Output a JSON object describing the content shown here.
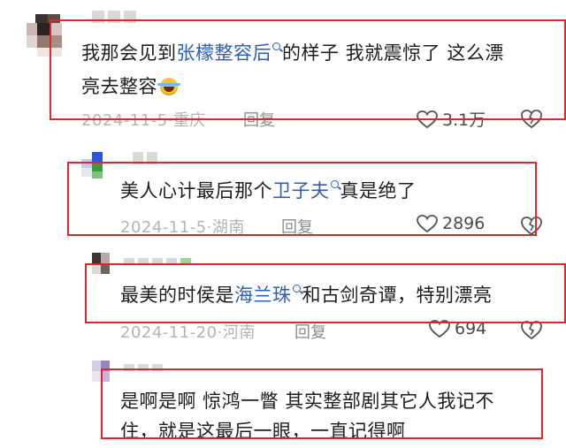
{
  "comments": [
    {
      "text_before": "我那会见到",
      "keyword": "张檬整容后",
      "text_after": "的样子 我就震惊了 这么漂",
      "line2": "亮去整容",
      "emoji": "laughing-crying-emoji",
      "date": "2024-11-5",
      "location": "重庆",
      "reply_label": "回复",
      "likes": "3.1万"
    },
    {
      "text_before": "美人心计最后那个",
      "keyword": "卫子夫",
      "text_after": "真是绝了",
      "date": "2024-11-5",
      "location": "湖南",
      "reply_label": "回复",
      "likes": "2896"
    },
    {
      "text_before": "最美的时侯是",
      "keyword": "海兰珠",
      "text_after": "和古剑奇谭，特别漂亮",
      "date": "2024-11-20",
      "location": "河南",
      "reply_label": "回复",
      "likes": "694"
    },
    {
      "text_before": "是啊是啊  惊鸿一瞥  其实整部剧其它人我记不",
      "line2": "住，就是这最后一眼，一直记得啊"
    }
  ],
  "separator": "·",
  "colors": {
    "keyword": "#2e5fb8",
    "highlight_box": "#e0252e",
    "meta": "#b4b4b4"
  }
}
